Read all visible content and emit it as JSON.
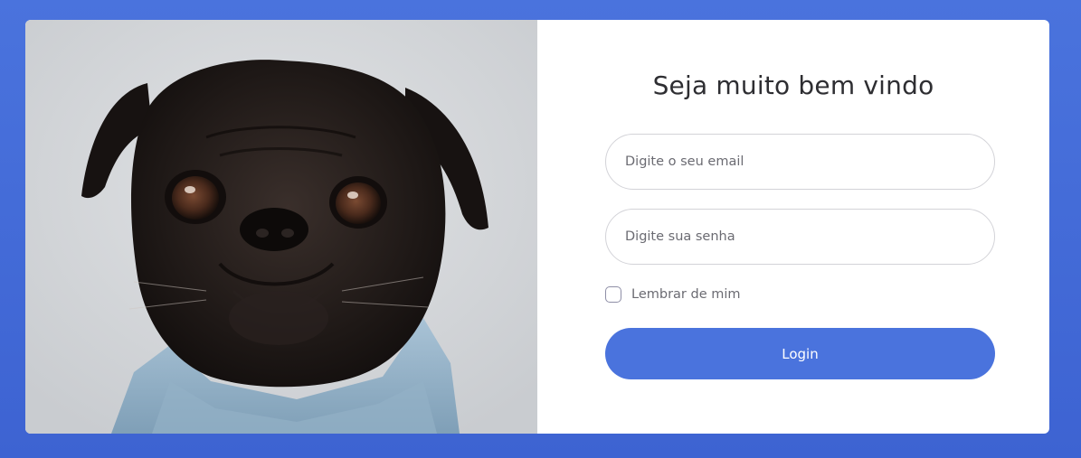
{
  "login": {
    "title": "Seja muito bem vindo",
    "email_placeholder": "Digite o seu email",
    "password_placeholder": "Digite sua senha",
    "remember_label": "Lembrar de mim",
    "remember_checked": false,
    "login_label": "Login"
  },
  "image": {
    "subject": "black pug wearing denim jacket"
  },
  "colors": {
    "accent": "#4a73dd",
    "background": "#4a73dd",
    "card": "#ffffff",
    "photo_background": "#d9dcdf"
  }
}
